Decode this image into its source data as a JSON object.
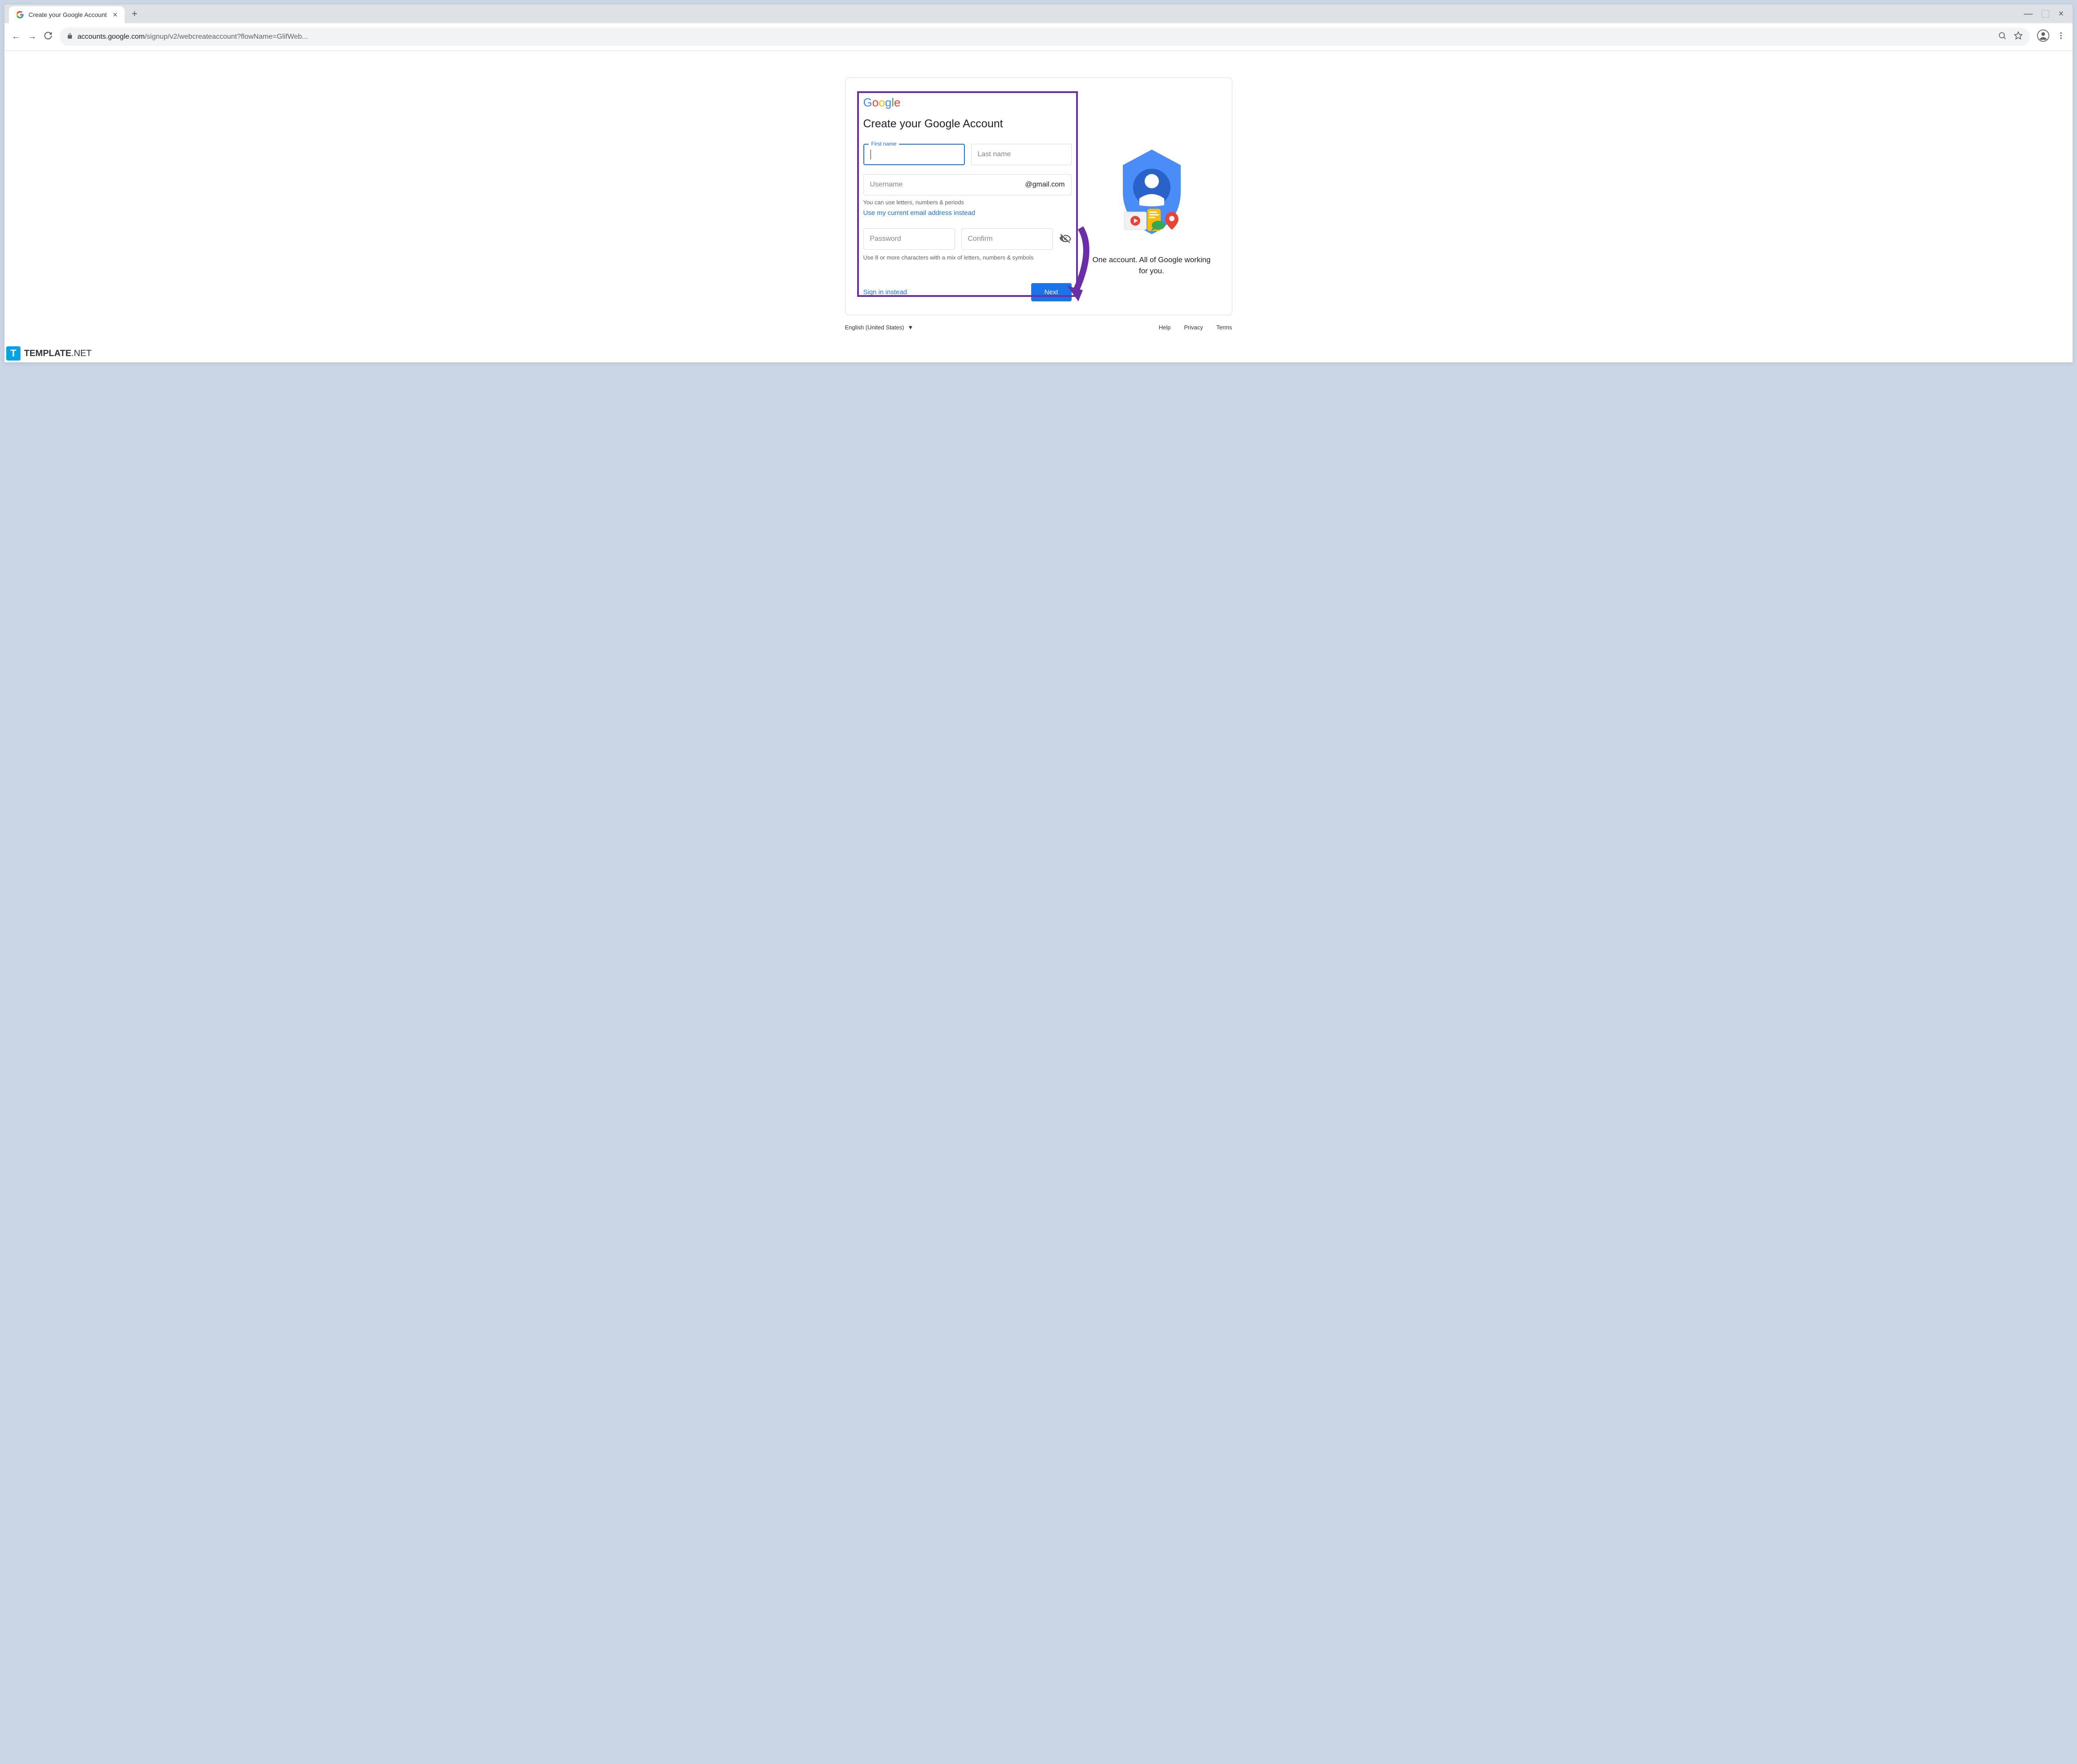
{
  "browser": {
    "tab_title": "Create your Google Account",
    "url_domain": "accounts.google.com",
    "url_path": "/signup/v2/webcreateaccount?flowName=GlifWeb..."
  },
  "logo": {
    "g1": "G",
    "o1": "o",
    "o2": "o",
    "g2": "g",
    "l": "l",
    "e": "e"
  },
  "form": {
    "heading": "Create your Google Account",
    "first_name_label": "First name",
    "last_name_placeholder": "Last name",
    "username_placeholder": "Username",
    "username_suffix": "@gmail.com",
    "username_hint": "You can use letters, numbers & periods",
    "use_current_email_link": "Use my current email address instead",
    "password_placeholder": "Password",
    "confirm_placeholder": "Confirm",
    "password_hint": "Use 8 or more characters with a mix of letters, numbers & symbols",
    "sign_in_link": "Sign in instead",
    "next_button": "Next"
  },
  "aside": {
    "tagline": "One account. All of Google working for you."
  },
  "footer": {
    "language": "English (United States)",
    "help": "Help",
    "privacy": "Privacy",
    "terms": "Terms"
  },
  "watermark": {
    "badge": "T",
    "text1": "TEMPLATE",
    "text2": ".NET"
  }
}
